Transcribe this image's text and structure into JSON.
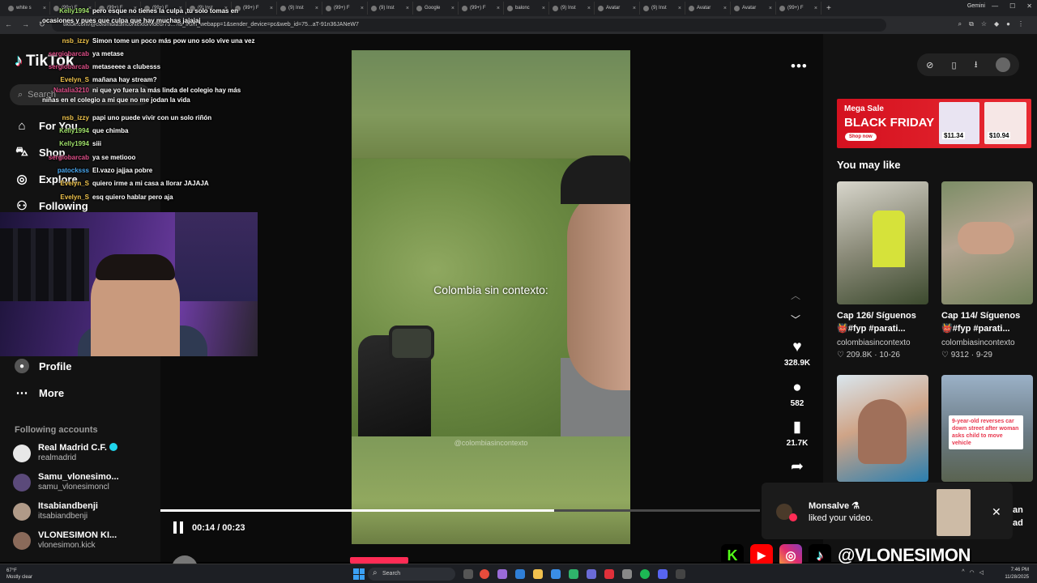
{
  "browser": {
    "tabs": [
      {
        "label": "white s"
      },
      {
        "label": "(99+) F"
      },
      {
        "label": "(99+) F"
      },
      {
        "label": "(99+) F"
      },
      {
        "label": "(9) Inst"
      },
      {
        "label": "(99+) F"
      },
      {
        "label": "(9) Inst"
      },
      {
        "label": "(99+) F"
      },
      {
        "label": "(9) Inst"
      },
      {
        "label": "Google"
      },
      {
        "label": "(99+) F"
      },
      {
        "label": "balonc"
      },
      {
        "label": "(9) Inst"
      },
      {
        "label": "Avatar"
      },
      {
        "label": "(9) Inst"
      },
      {
        "label": "Avatar"
      },
      {
        "label": "Avatar"
      },
      {
        "label": "(99+) F"
      }
    ],
    "gemini_label": "Gemini",
    "url": "tiktok.com/@colombiasincontexto/video/75...?is_from_webapp=1&sender_device=pc&web_id=75...aT-91n36JANeW7"
  },
  "sidebar": {
    "logo": "TikTok",
    "search_placeholder": "Search",
    "nav": [
      {
        "label": "For You",
        "icon": "home-icon"
      },
      {
        "label": "Shop",
        "icon": "shopping-bag-icon"
      },
      {
        "label": "Explore",
        "icon": "compass-icon"
      },
      {
        "label": "Following",
        "icon": "following-icon"
      },
      {
        "label": "Profile",
        "icon": "profile-icon"
      },
      {
        "label": "More",
        "icon": "more-icon"
      }
    ],
    "following_header": "Following accounts",
    "accounts": [
      {
        "name": "Real Madrid C.F.",
        "handle": "realmadrid",
        "verified": true
      },
      {
        "name": "Samu_vlonesimo...",
        "handle": "samu_vlonesimoncl"
      },
      {
        "name": "Itsabiandbenji",
        "handle": "itsabiandbenji"
      },
      {
        "name": "VLONESIMON KI...",
        "handle": "vlonesimon.kick"
      }
    ]
  },
  "chat": [
    {
      "user": "Kelly1994",
      "msg": "pero esque no tienes la culpa ,tu solo tomas en ocasiones y pues que culpa que hay muchas jajajaj",
      "color": "#9fe06a"
    },
    {
      "user": "nsb_izzy",
      "msg": "Simon tome un poco más pow uno solo vive una vez",
      "color": "#f0c44c"
    },
    {
      "user": "sergiobarcab",
      "msg": "ya metase",
      "color": "#e0508a"
    },
    {
      "user": "sergiobarcab",
      "msg": "metaseeee a clubesss",
      "color": "#e0508a"
    },
    {
      "user": "Evelyn_S",
      "msg": "mañana hay stream?",
      "color": "#f0c44c"
    },
    {
      "user": "Natalia3210",
      "msg": "ni que yo fuera la más linda del colegio hay más niñas en el colegio a mi que no me jodan la vida",
      "color": "#e0508a"
    },
    {
      "user": "nsb_izzy",
      "msg": "papi uno puede vivir con un solo riñón",
      "color": "#f0c44c"
    },
    {
      "user": "Kelly1994",
      "msg": "que chimba",
      "color": "#9fe06a"
    },
    {
      "user": "Kelly1994",
      "msg": "siii",
      "color": "#9fe06a"
    },
    {
      "user": "sergiobarcab",
      "msg": "ya se metiooo",
      "color": "#e0508a"
    },
    {
      "user": "patocksss",
      "msg": "El.vazo jajjaa pobre",
      "color": "#4aa8f0"
    },
    {
      "user": "Evelyn_S",
      "msg": "quiero irme a mi casa a llorar JAJAJA",
      "color": "#f0c44c"
    },
    {
      "user": "Evelyn_S",
      "msg": "esq quiero hablar pero aja",
      "color": "#f0c44c"
    }
  ],
  "video": {
    "caption": "Colombia sin contexto:",
    "watermark": "@colombiasincontexto",
    "time": "00:14 / 00:23",
    "progress": 0.657,
    "author": "colombiasincontexto"
  },
  "actions": {
    "likes": "328.9K",
    "comments": "582",
    "saves": "21.7K"
  },
  "ad": {
    "line1": "Mega Sale",
    "line2": "BLACK FRIDAY",
    "cta": "Shop now",
    "price1": "$11.34",
    "price2": "$10.94"
  },
  "recommend": {
    "header": "You may like",
    "items": [
      {
        "title1": "Cap 126/ Síguenos",
        "title2": "👹#fyp #parati...",
        "account": "colombiasincontexto",
        "likes": "209.8K",
        "date": "10-26"
      },
      {
        "title1": "Cap 114/ Síguenos",
        "title2": "👹#fyp #parati...",
        "account": "colombiasincontexto",
        "likes": "9312",
        "date": "9-29"
      },
      {
        "title1": "",
        "title2": "",
        "account": "",
        "likes": "",
        "date": ""
      },
      {
        "title1": "an",
        "title2": "ad",
        "account": "",
        "likes": "",
        "date": "",
        "overlay": "9-year-old reverses car down street after woman asks child to move vehicle"
      }
    ]
  },
  "notification": {
    "name": "Monsalve ⚗",
    "text": "liked your video."
  },
  "stream_handle": "@VLONESIMON",
  "taskbar": {
    "weather_temp": "67°F",
    "weather_text": "Mostly clear",
    "search": "Search",
    "time": "7:46 PM",
    "date": "11/28/2025"
  },
  "colors": {
    "accent": "#fe2c55",
    "teal": "#25f4ee",
    "kick": "#53fc18"
  }
}
